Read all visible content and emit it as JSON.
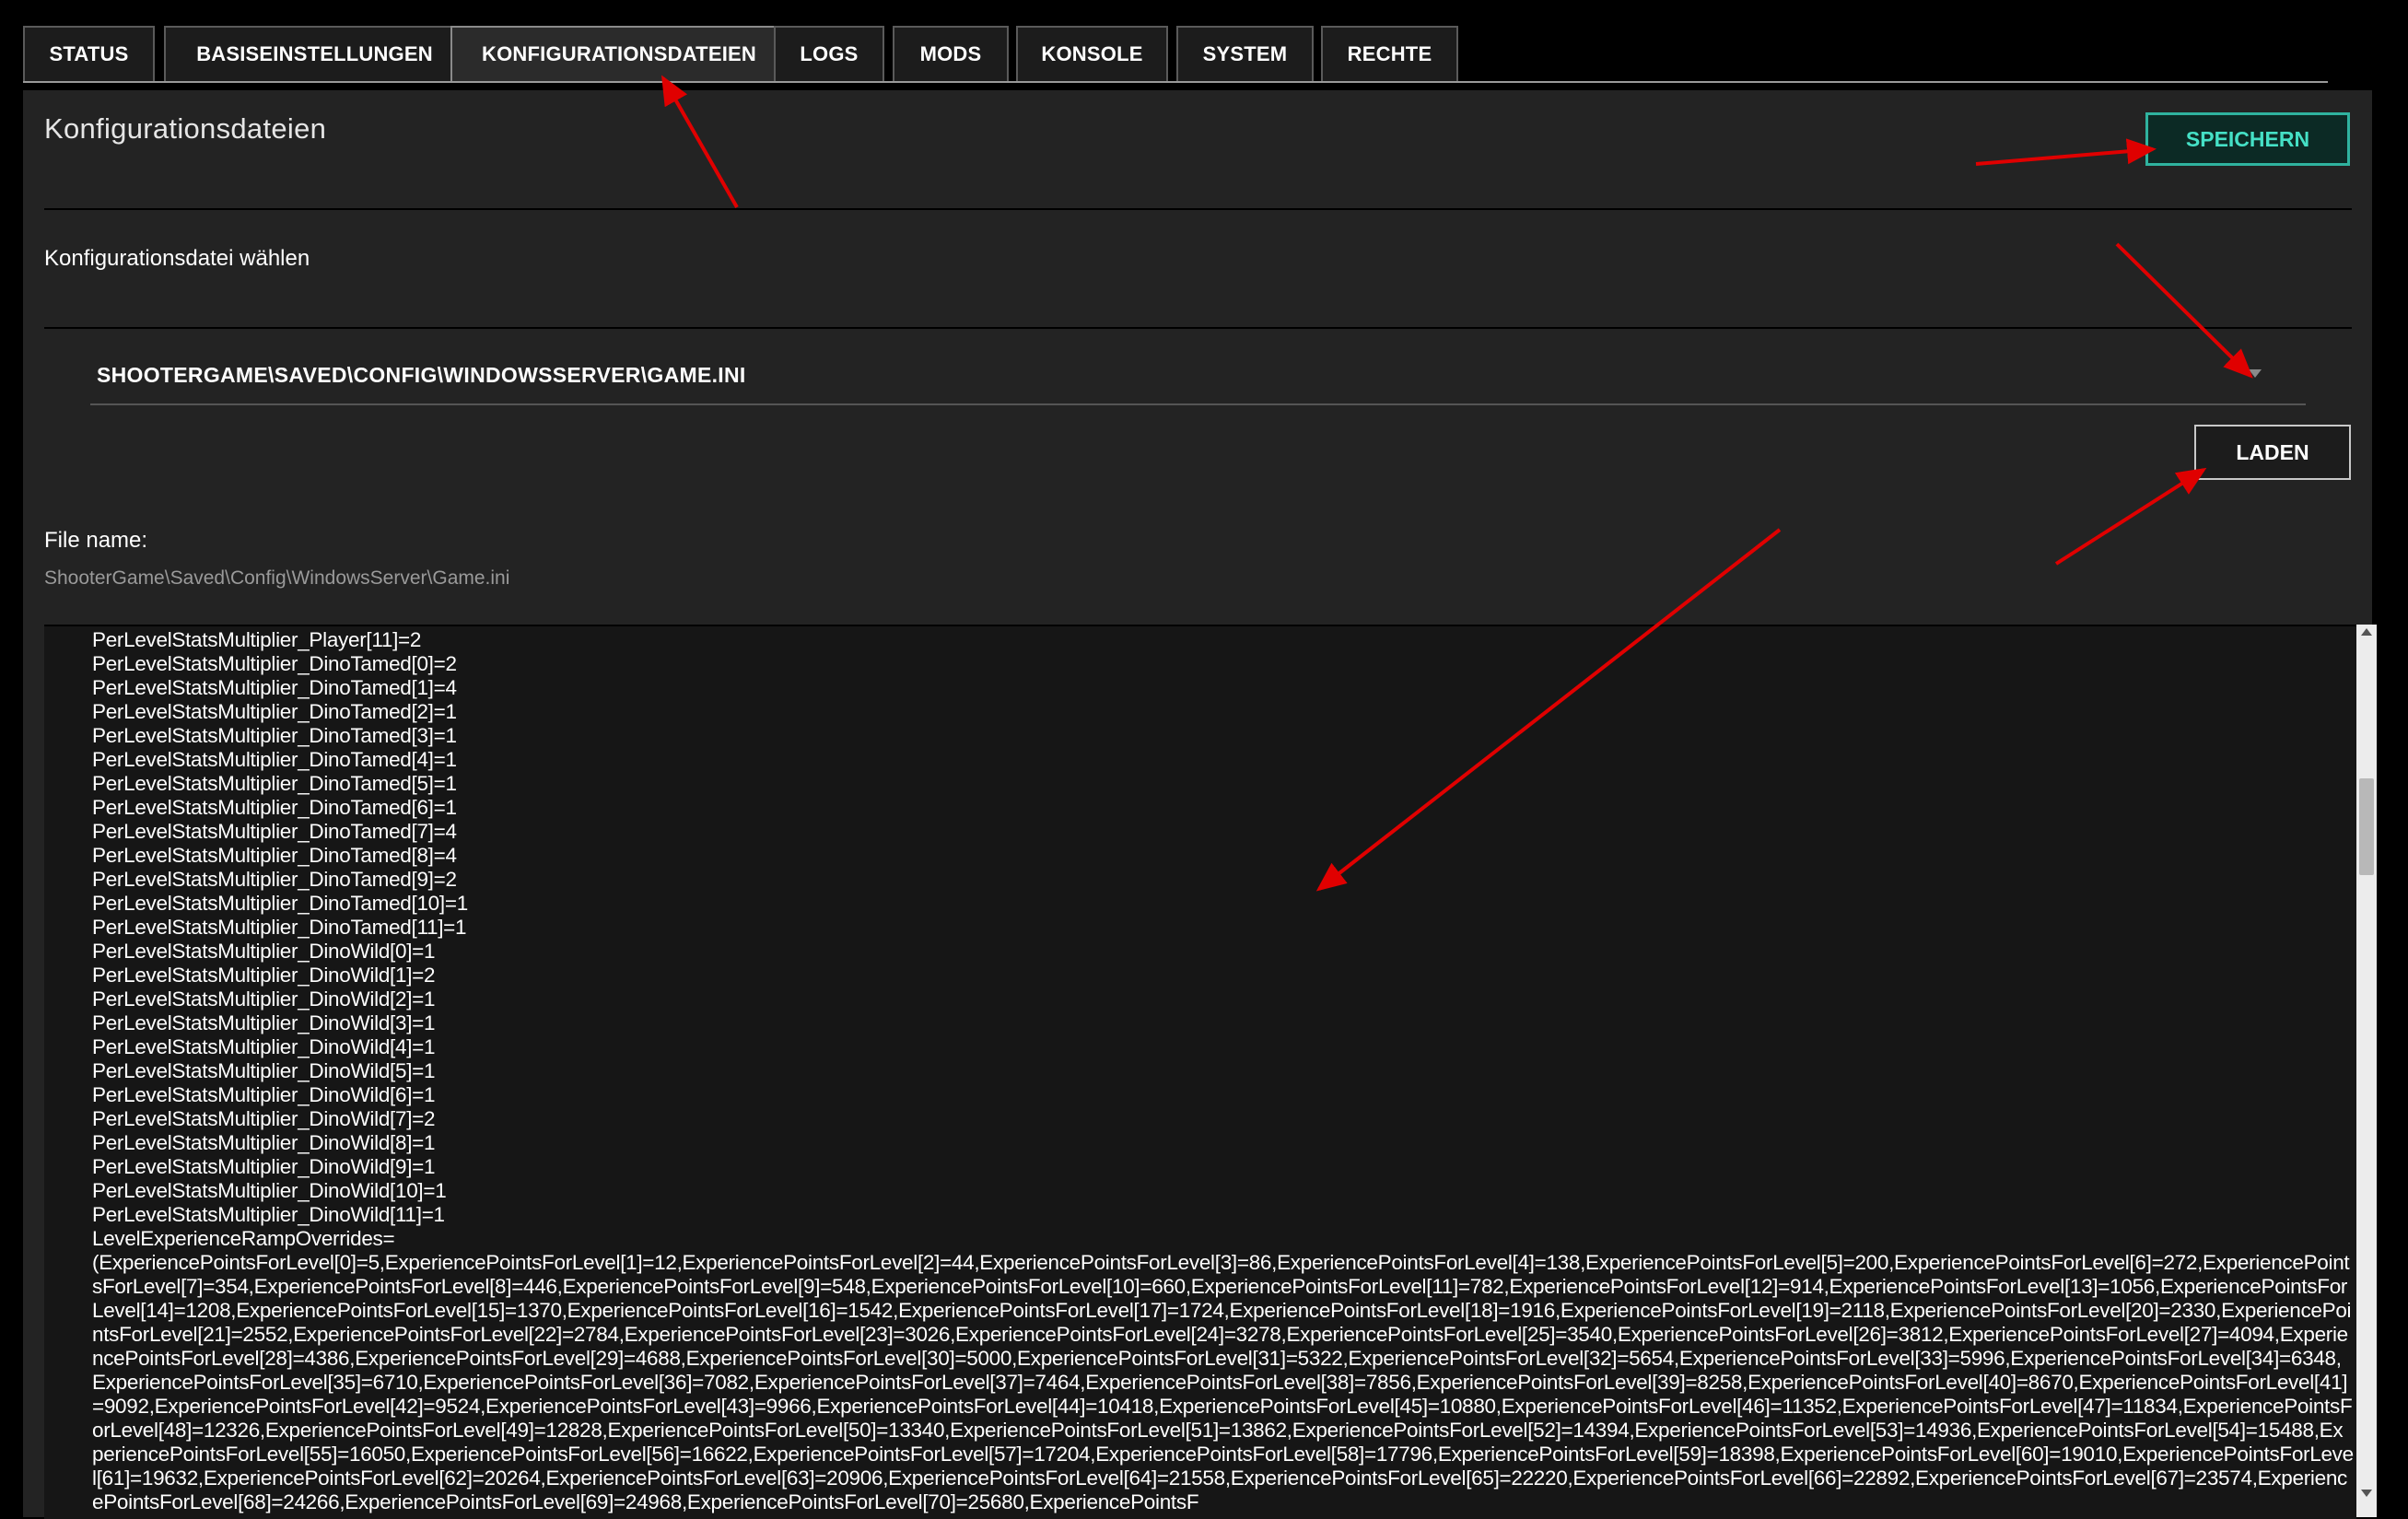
{
  "tabs": [
    {
      "label": "STATUS",
      "active": false
    },
    {
      "label": "BASISEINSTELLUNGEN",
      "active": false
    },
    {
      "label": "KONFIGURATIONSDATEIEN",
      "active": true
    },
    {
      "label": "LOGS",
      "active": false
    },
    {
      "label": "MODS",
      "active": false
    },
    {
      "label": "KONSOLE",
      "active": false
    },
    {
      "label": "SYSTEM",
      "active": false
    },
    {
      "label": "RECHTE",
      "active": false
    }
  ],
  "panel": {
    "title": "Konfigurationsdateien",
    "save_label": "SPEICHERN",
    "select_label": "Konfigurationsdatei wählen",
    "select_value": "SHOOTERGAME\\SAVED\\CONFIG\\WINDOWSSERVER\\GAME.INI",
    "load_label": "LADEN",
    "filename_label": "File name:",
    "filename_value": "ShooterGame\\Saved\\Config\\WindowsServer\\Game.ini"
  },
  "editor": {
    "content": "PerLevelStatsMultiplier_Player[11]=2\nPerLevelStatsMultiplier_DinoTamed[0]=2\nPerLevelStatsMultiplier_DinoTamed[1]=4\nPerLevelStatsMultiplier_DinoTamed[2]=1\nPerLevelStatsMultiplier_DinoTamed[3]=1\nPerLevelStatsMultiplier_DinoTamed[4]=1\nPerLevelStatsMultiplier_DinoTamed[5]=1\nPerLevelStatsMultiplier_DinoTamed[6]=1\nPerLevelStatsMultiplier_DinoTamed[7]=4\nPerLevelStatsMultiplier_DinoTamed[8]=4\nPerLevelStatsMultiplier_DinoTamed[9]=2\nPerLevelStatsMultiplier_DinoTamed[10]=1\nPerLevelStatsMultiplier_DinoTamed[11]=1\nPerLevelStatsMultiplier_DinoWild[0]=1\nPerLevelStatsMultiplier_DinoWild[1]=2\nPerLevelStatsMultiplier_DinoWild[2]=1\nPerLevelStatsMultiplier_DinoWild[3]=1\nPerLevelStatsMultiplier_DinoWild[4]=1\nPerLevelStatsMultiplier_DinoWild[5]=1\nPerLevelStatsMultiplier_DinoWild[6]=1\nPerLevelStatsMultiplier_DinoWild[7]=2\nPerLevelStatsMultiplier_DinoWild[8]=1\nPerLevelStatsMultiplier_DinoWild[9]=1\nPerLevelStatsMultiplier_DinoWild[10]=1\nPerLevelStatsMultiplier_DinoWild[11]=1\nLevelExperienceRampOverrides=\n(ExperiencePointsForLevel[0]=5,ExperiencePointsForLevel[1]=12,ExperiencePointsForLevel[2]=44,ExperiencePointsForLevel[3]=86,ExperiencePointsForLevel[4]=138,ExperiencePointsForLevel[5]=200,ExperiencePointsForLevel[6]=272,ExperiencePointsForLevel[7]=354,ExperiencePointsForLevel[8]=446,ExperiencePointsForLevel[9]=548,ExperiencePointsForLevel[10]=660,ExperiencePointsForLevel[11]=782,ExperiencePointsForLevel[12]=914,ExperiencePointsForLevel[13]=1056,ExperiencePointsForLevel[14]=1208,ExperiencePointsForLevel[15]=1370,ExperiencePointsForLevel[16]=1542,ExperiencePointsForLevel[17]=1724,ExperiencePointsForLevel[18]=1916,ExperiencePointsForLevel[19]=2118,ExperiencePointsForLevel[20]=2330,ExperiencePointsForLevel[21]=2552,ExperiencePointsForLevel[22]=2784,ExperiencePointsForLevel[23]=3026,ExperiencePointsForLevel[24]=3278,ExperiencePointsForLevel[25]=3540,ExperiencePointsForLevel[26]=3812,ExperiencePointsForLevel[27]=4094,ExperiencePointsForLevel[28]=4386,ExperiencePointsForLevel[29]=4688,ExperiencePointsForLevel[30]=5000,ExperiencePointsForLevel[31]=5322,ExperiencePointsForLevel[32]=5654,ExperiencePointsForLevel[33]=5996,ExperiencePointsForLevel[34]=6348,ExperiencePointsForLevel[35]=6710,ExperiencePointsForLevel[36]=7082,ExperiencePointsForLevel[37]=7464,ExperiencePointsForLevel[38]=7856,ExperiencePointsForLevel[39]=8258,ExperiencePointsForLevel[40]=8670,ExperiencePointsForLevel[41]=9092,ExperiencePointsForLevel[42]=9524,ExperiencePointsForLevel[43]=9966,ExperiencePointsForLevel[44]=10418,ExperiencePointsForLevel[45]=10880,ExperiencePointsForLevel[46]=11352,ExperiencePointsForLevel[47]=11834,ExperiencePointsForLevel[48]=12326,ExperiencePointsForLevel[49]=12828,ExperiencePointsForLevel[50]=13340,ExperiencePointsForLevel[51]=13862,ExperiencePointsForLevel[52]=14394,ExperiencePointsForLevel[53]=14936,ExperiencePointsForLevel[54]=15488,ExperiencePointsForLevel[55]=16050,ExperiencePointsForLevel[56]=16622,ExperiencePointsForLevel[57]=17204,ExperiencePointsForLevel[58]=17796,ExperiencePointsForLevel[59]=18398,ExperiencePointsForLevel[60]=19010,ExperiencePointsForLevel[61]=19632,ExperiencePointsForLevel[62]=20264,ExperiencePointsForLevel[63]=20906,ExperiencePointsForLevel[64]=21558,ExperiencePointsForLevel[65]=22220,ExperiencePointsForLevel[66]=22892,ExperiencePointsForLevel[67]=23574,ExperiencePointsForLevel[68]=24266,ExperiencePointsForLevel[69]=24968,ExperiencePointsForLevel[70]=25680,ExperiencePointsF"
  },
  "colors": {
    "background": "#000000",
    "panel": "#232323",
    "accent": "#45e0c6",
    "annotation_arrow": "#e00000"
  }
}
